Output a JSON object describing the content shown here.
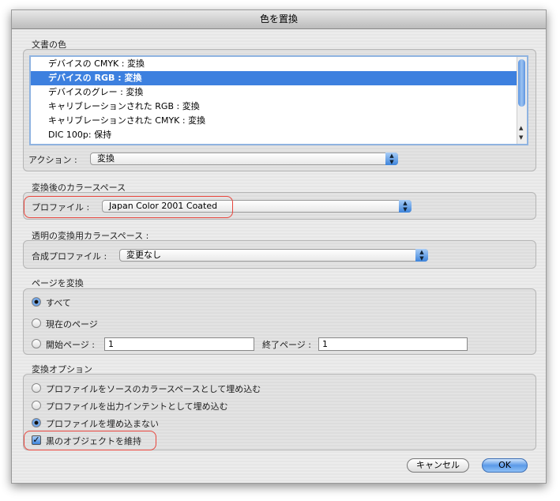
{
  "title": "色を置換",
  "doc_colors": {
    "label": "文書の色",
    "items": [
      "デバイスの CMYK : 変換",
      "デバイスの RGB : 変換",
      "デバイスのグレー : 変換",
      "キャリブレーションされた RGB : 変換",
      "キャリブレーションされた CMYK : 変換",
      "DIC 100p: 保持"
    ],
    "selected_index": 1,
    "action_label": "アクション :",
    "action_value": "変換"
  },
  "dest_space": {
    "label": "変換後のカラースペース",
    "profile_label": "プロファイル :",
    "profile_value": "Japan Color 2001 Coated"
  },
  "transparency": {
    "label": "透明の変換用カラースペース :",
    "profile_label": "合成プロファイル :",
    "profile_value": "変更なし"
  },
  "pages": {
    "label": "ページを変換",
    "all": "すべて",
    "current": "現在のページ",
    "start_label": "開始ページ :",
    "start_value": "1",
    "end_label": "終了ページ :",
    "end_value": "1",
    "selected": "all"
  },
  "options": {
    "label": "変換オプション",
    "embed_source": "プロファイルをソースのカラースペースとして埋め込む",
    "embed_output": "プロファイルを出力インテントとして埋め込む",
    "no_embed": "プロファイルを埋め込まない",
    "preserve_black": "黒のオブジェクトを維持",
    "selected": "no_embed",
    "preserve_black_checked": true
  },
  "buttons": {
    "cancel": "キャンセル",
    "ok": "OK"
  },
  "colors": {
    "selection": "#3d80df",
    "highlight": "#e8453c"
  }
}
